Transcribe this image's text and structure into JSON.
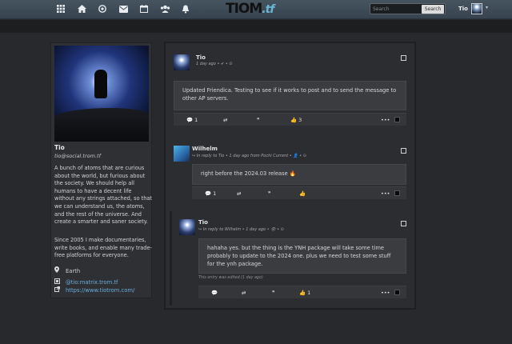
{
  "topbar": {
    "logo_main": "TIOM",
    "logo_suffix": ".tf",
    "search_placeholder": "Search",
    "search_button": "Search",
    "user_name": "Tio",
    "caret": "▾"
  },
  "nav_icons": [
    "apps-grid-icon",
    "home-icon",
    "network-icon",
    "messages-icon",
    "calendar-icon",
    "contacts-icon",
    "notifications-icon"
  ],
  "profile": {
    "name": "Tio",
    "handle": "tio@social.trom.tf",
    "bio": "A bunch of atoms that are curious about the world, but furious about the society. We should help all humans to have a decent life without any strings attached, so that we can understand us, the atoms, and the rest of the universe. And create a smarter and saner society.",
    "bio2": "Since 2005 I make documentaries, write books, and enable many trade-free platforms for everyone.",
    "location": "Earth",
    "matrix": "@tio:matrix.trom.tf",
    "website": "https://www.tiotrom.com/"
  },
  "posts": [
    {
      "author": "Tio",
      "meta": "1 day ago • ✔ • ⊙",
      "body": "Updated Friendica. Testing to see if it works to post and to send the message to other AP servers.",
      "comments": "1",
      "likes": "3"
    },
    {
      "author": "Wilhelm",
      "meta": "↪ In reply to Tio • 1 day ago from Pochi Current • 👤 • ⊙",
      "body": "right before the 2024.03 release 🔥",
      "comments": "1",
      "likes": ""
    },
    {
      "author": "Tio",
      "meta": "↪ In reply to Wilhelm • 1 day ago • 👁 • ⊙",
      "body": "hahaha yes. but the thing is the YNH package will take some time probably to update to the 2024 one. plus we need to test some stuff for the ynh package.",
      "comments": "",
      "likes": "1",
      "edited": "This entry was edited (1 day ago)"
    }
  ],
  "colors": {
    "background": "#27292c",
    "topbar": "#3f4c57",
    "panel": "#2e3033",
    "post_body": "#3a3c3f",
    "link": "#6aaee0"
  }
}
